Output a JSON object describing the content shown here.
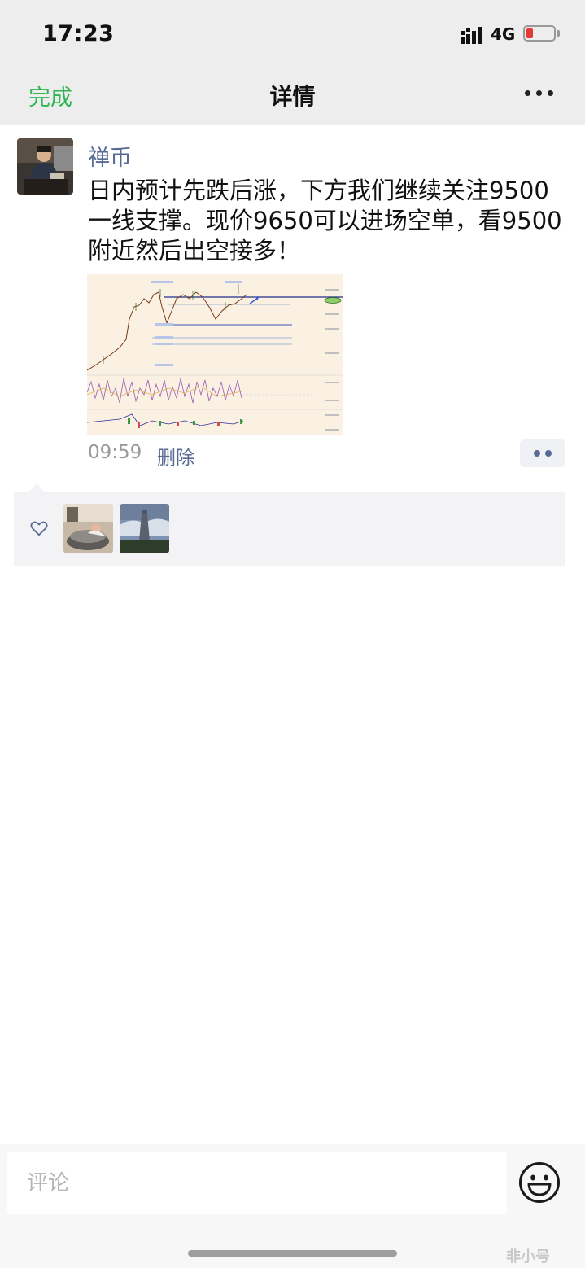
{
  "status_bar": {
    "time": "17:23",
    "network": "4G",
    "battery_level": 0.18,
    "battery_color": "#e53935"
  },
  "nav": {
    "done_label": "完成",
    "title": "详情",
    "more_icon": "more-dots-icon",
    "accent": "#2fb553"
  },
  "post": {
    "username": "禅币",
    "text": "日内预计先跌后涨，下方我们继续关注9500一线支撑。现价9650可以进场空单，看9500附近然后出空接多！",
    "time": "09:59",
    "delete_label": "删除",
    "name_color": "#576b95"
  },
  "likes": {
    "icon": "heart-icon",
    "likers": [
      "liker-1",
      "liker-2"
    ]
  },
  "comment_bar": {
    "placeholder": "评论",
    "emoji_icon": "emoji-icon"
  },
  "watermark": "非小号"
}
